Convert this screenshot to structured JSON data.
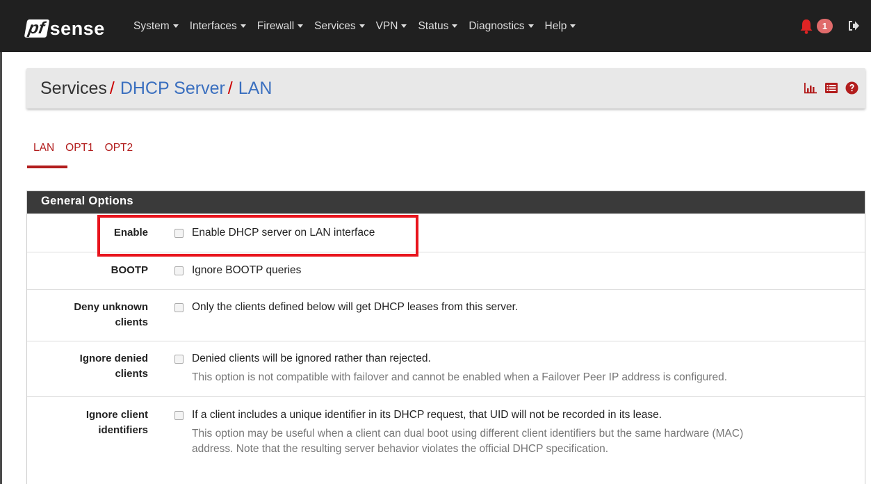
{
  "navbar": {
    "brand_pf": "pf",
    "brand_sense": "sense",
    "menu": [
      {
        "label": "System"
      },
      {
        "label": "Interfaces"
      },
      {
        "label": "Firewall"
      },
      {
        "label": "Services"
      },
      {
        "label": "VPN"
      },
      {
        "label": "Status"
      },
      {
        "label": "Diagnostics"
      },
      {
        "label": "Help"
      }
    ],
    "notification_count": "1"
  },
  "breadcrumb": {
    "root": "Services",
    "sep": "/",
    "item1": "DHCP Server",
    "item2": "LAN"
  },
  "tabs": [
    {
      "label": "LAN",
      "active": true
    },
    {
      "label": "OPT1"
    },
    {
      "label": "OPT2"
    }
  ],
  "panel": {
    "title": "General Options",
    "rows": [
      {
        "label": "Enable",
        "checkbox": "Enable DHCP server on LAN interface",
        "checked": false
      },
      {
        "label": "BOOTP",
        "checkbox": "Ignore BOOTP queries",
        "checked": false
      },
      {
        "label_line1": "Deny unknown",
        "label_line2": "clients",
        "checkbox": "Only the clients defined below will get DHCP leases from this server.",
        "checked": false
      },
      {
        "label_line1": "Ignore denied",
        "label_line2": "clients",
        "checkbox": "Denied clients will be ignored rather than rejected.",
        "help": "This option is not compatible with failover and cannot be enabled when a Failover Peer IP address is configured.",
        "checked": false
      },
      {
        "label_line1": "Ignore client",
        "label_line2": "identifiers",
        "checkbox": "If a client includes a unique identifier in its DHCP request, that UID will not be recorded in its lease.",
        "help_line1": "This option may be useful when a client can dual boot using different client identifiers but the same hardware (MAC)",
        "help_line2": "address. Note that the resulting server behavior violates the official DHCP specification.",
        "checked": false
      }
    ]
  },
  "colors": {
    "navbar_bg": "#202020",
    "accent_red": "#b21d1d",
    "link_blue": "#3a6fbf",
    "highlight_red": "#e8141d"
  }
}
